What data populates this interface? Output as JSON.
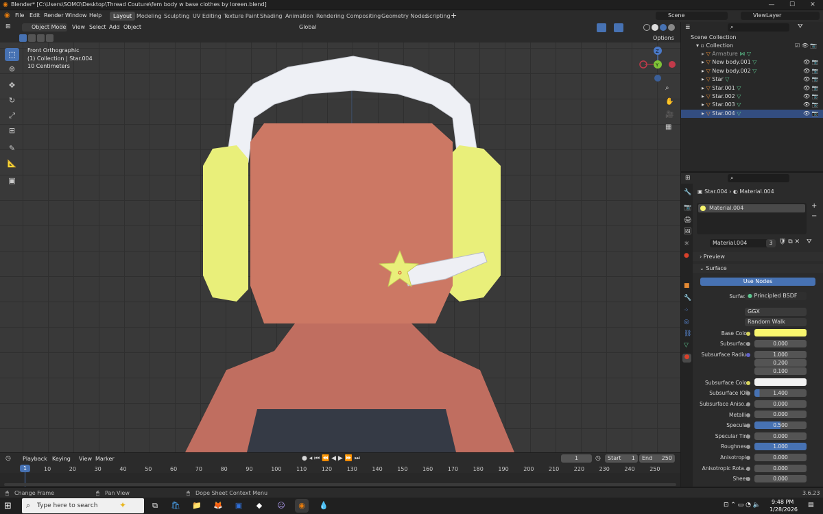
{
  "window": {
    "title": "Blender* [C:\\Users\\SOMO\\Desktop\\Thread Couture\\fem body w base clothes by loreen.blend]",
    "minimize": "—",
    "maximize": "☐",
    "close": "✕"
  },
  "menu": [
    "File",
    "Edit",
    "Render",
    "Window",
    "Help"
  ],
  "workspaces": [
    "Layout",
    "Modeling",
    "Sculpting",
    "UV Editing",
    "Texture Paint",
    "Shading",
    "Animation",
    "Rendering",
    "Compositing",
    "Geometry Nodes",
    "Scripting"
  ],
  "scene": {
    "scene_name": "Scene",
    "view_layer": "ViewLayer"
  },
  "viewport": {
    "header": {
      "mode": "Object Mode",
      "view": "View",
      "select": "Select",
      "add": "Add",
      "object": "Object",
      "orientation": "Global",
      "options": "Options"
    },
    "overlay": {
      "view_name": "Front Orthographic",
      "collection_info": "(1) Collection | Star.004",
      "scale": "10 Centimeters"
    },
    "gizmo": {
      "z": "Z",
      "y": "Y"
    }
  },
  "outliner": {
    "root": "Scene Collection",
    "collection": "Collection",
    "items": [
      {
        "name": "Armature"
      },
      {
        "name": "New body.001"
      },
      {
        "name": "New body.002"
      },
      {
        "name": "Star"
      },
      {
        "name": "Star.001"
      },
      {
        "name": "Star.002"
      },
      {
        "name": "Star.003"
      },
      {
        "name": "Star.004"
      }
    ]
  },
  "properties": {
    "breadcrumb_object": "Star.004",
    "breadcrumb_material": "Material.004",
    "slot": "Material.004",
    "material_name": "Material.004",
    "user_count": "3",
    "preview": "Preview",
    "surface_panel": "Surface",
    "use_nodes": "Use Nodes",
    "surface_label": "Surface",
    "surface_value": "Principled BSDF",
    "distribution": "GGX",
    "subsurface_method": "Random Walk",
    "base_color_hex": "#f7f56e",
    "subsurface_color_hex": "#f2f2f2",
    "fields": [
      {
        "label": "Base Color",
        "value": ""
      },
      {
        "label": "Subsurface",
        "value": "0.000"
      },
      {
        "label": "Subsurface Radius",
        "value": "1.000"
      },
      {
        "label": "",
        "value": "0.200"
      },
      {
        "label": "",
        "value": "0.100"
      },
      {
        "label": "Subsurface Color",
        "value": ""
      },
      {
        "label": "Subsurface IOR",
        "value": "1.400"
      },
      {
        "label": "Subsurface Aniso...",
        "value": "0.000"
      },
      {
        "label": "Metallic",
        "value": "0.000"
      },
      {
        "label": "Specular",
        "value": "0.500"
      },
      {
        "label": "Specular Tint",
        "value": "0.000"
      },
      {
        "label": "Roughness",
        "value": "1.000"
      },
      {
        "label": "Anisotropic",
        "value": "0.000"
      },
      {
        "label": "Anisotropic Rota...",
        "value": "0.000"
      },
      {
        "label": "Sheen",
        "value": "0.000"
      }
    ]
  },
  "timeline": {
    "playback": "Playback",
    "keying": "Keying",
    "view": "View",
    "marker": "Marker",
    "current_frame": "1",
    "start_label": "Start",
    "start": "1",
    "end_label": "End",
    "end": "250",
    "ticks": [
      "10",
      "20",
      "30",
      "40",
      "50",
      "60",
      "70",
      "80",
      "90",
      "100",
      "110",
      "120",
      "130",
      "140",
      "150",
      "160",
      "170",
      "180",
      "190",
      "200",
      "210",
      "220",
      "230",
      "240",
      "250"
    ]
  },
  "status": {
    "left": "Change Frame",
    "middle": "Pan View",
    "right": "Dope Sheet Context Menu",
    "version": "3.6.23"
  },
  "taskbar": {
    "search_placeholder": "Type here to search",
    "time": "9:48 PM",
    "date": "1/28/2026"
  }
}
